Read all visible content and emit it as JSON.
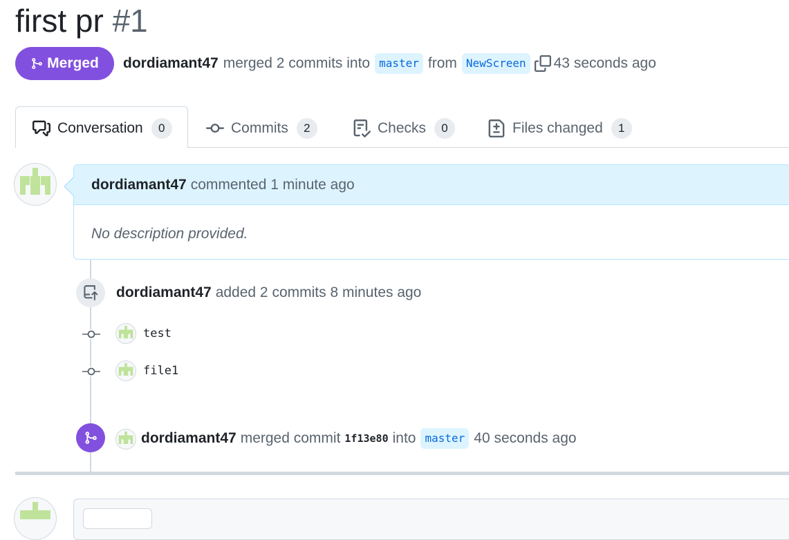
{
  "pr": {
    "title": "first pr",
    "number": "#1"
  },
  "status": {
    "badge_label": "Merged",
    "author": "dordiamant47",
    "text_merged": "merged 2 commits into",
    "base_branch": "master",
    "text_from": "from",
    "head_branch": "NewScreen",
    "time_ago": "43 seconds ago"
  },
  "tabs": [
    {
      "label": "Conversation",
      "count": "0",
      "icon": "comment-discussion-icon",
      "active": true
    },
    {
      "label": "Commits",
      "count": "2",
      "icon": "git-commit-icon"
    },
    {
      "label": "Checks",
      "count": "0",
      "icon": "checklist-icon"
    },
    {
      "label": "Files changed",
      "count": "1",
      "icon": "file-diff-icon"
    }
  ],
  "comment": {
    "author": "dordiamant47",
    "action": "commented 1 minute ago",
    "body": "No description provided."
  },
  "timeline": {
    "commits_event": {
      "author": "dordiamant47",
      "text": "added 2 commits 8 minutes ago",
      "commits": [
        {
          "message": "test"
        },
        {
          "message": "file1"
        }
      ]
    },
    "merge_event": {
      "author": "dordiamant47",
      "text_merged": "merged commit",
      "sha": "1f13e80",
      "text_into": "into",
      "branch": "master",
      "time_ago": "40 seconds ago"
    }
  },
  "colors": {
    "merged": "#8250df",
    "accent": "#0969da",
    "branch_bg": "#ddf4ff"
  }
}
